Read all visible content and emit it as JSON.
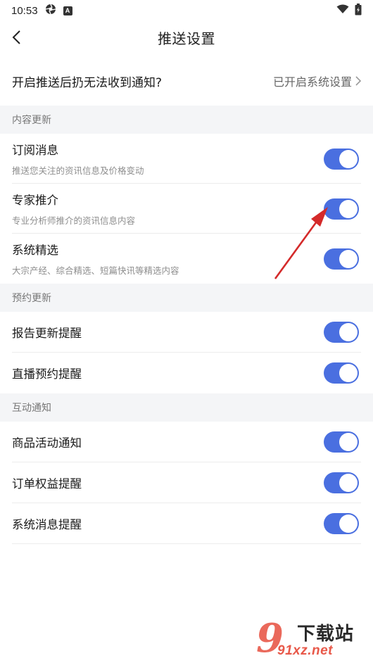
{
  "status_bar": {
    "time": "10:53",
    "badge": "A"
  },
  "header": {
    "title": "推送设置"
  },
  "top_row": {
    "label": "开启推送后扔无法收到通知?",
    "status": "已开启系统设置"
  },
  "sections": [
    {
      "title": "内容更新"
    },
    {
      "title": "预约更新"
    },
    {
      "title": "互动通知"
    }
  ],
  "items": {
    "subscription": {
      "title": "订阅消息",
      "desc": "推送您关注的资讯信息及价格变动",
      "enabled": true
    },
    "expert": {
      "title": "专家推介",
      "desc": "专业分析师推介的资讯信息内容",
      "enabled": true
    },
    "system_pick": {
      "title": "系统精选",
      "desc": "大宗产经、综合精选、短篇快讯等精选内容",
      "enabled": true
    },
    "report": {
      "title": "报告更新提醒",
      "enabled": true
    },
    "live": {
      "title": "直播预约提醒",
      "enabled": true
    },
    "activity": {
      "title": "商品活动通知",
      "enabled": true
    },
    "order": {
      "title": "订单权益提醒",
      "enabled": true
    },
    "sysmsg": {
      "title": "系统消息提醒",
      "enabled": true
    }
  },
  "colors": {
    "toggle_on": "#4a6fe0",
    "annotation_arrow": "#d42a2a",
    "section_bg": "#f4f5f7"
  },
  "watermark": {
    "logo": "9",
    "brand": "下载站",
    "url": "91xz.net"
  }
}
